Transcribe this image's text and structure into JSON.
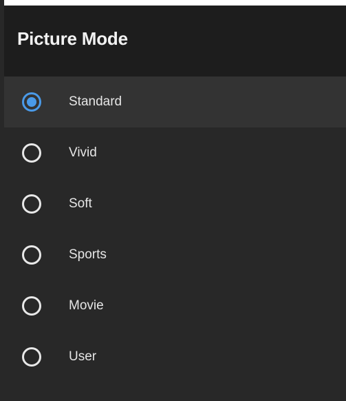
{
  "header": {
    "title": "Picture Mode"
  },
  "options": [
    {
      "label": "Standard",
      "selected": true
    },
    {
      "label": "Vivid",
      "selected": false
    },
    {
      "label": "Soft",
      "selected": false
    },
    {
      "label": "Sports",
      "selected": false
    },
    {
      "label": "Movie",
      "selected": false
    },
    {
      "label": "User",
      "selected": false
    }
  ],
  "colors": {
    "accent": "#4a9ae8",
    "background": "#282828",
    "header_background": "#1d1d1d",
    "selected_row": "#333333",
    "text": "#e6e6e6"
  },
  "icons": {
    "radio_checked": "radio-checked-icon",
    "radio_unchecked": "radio-unchecked-icon"
  }
}
